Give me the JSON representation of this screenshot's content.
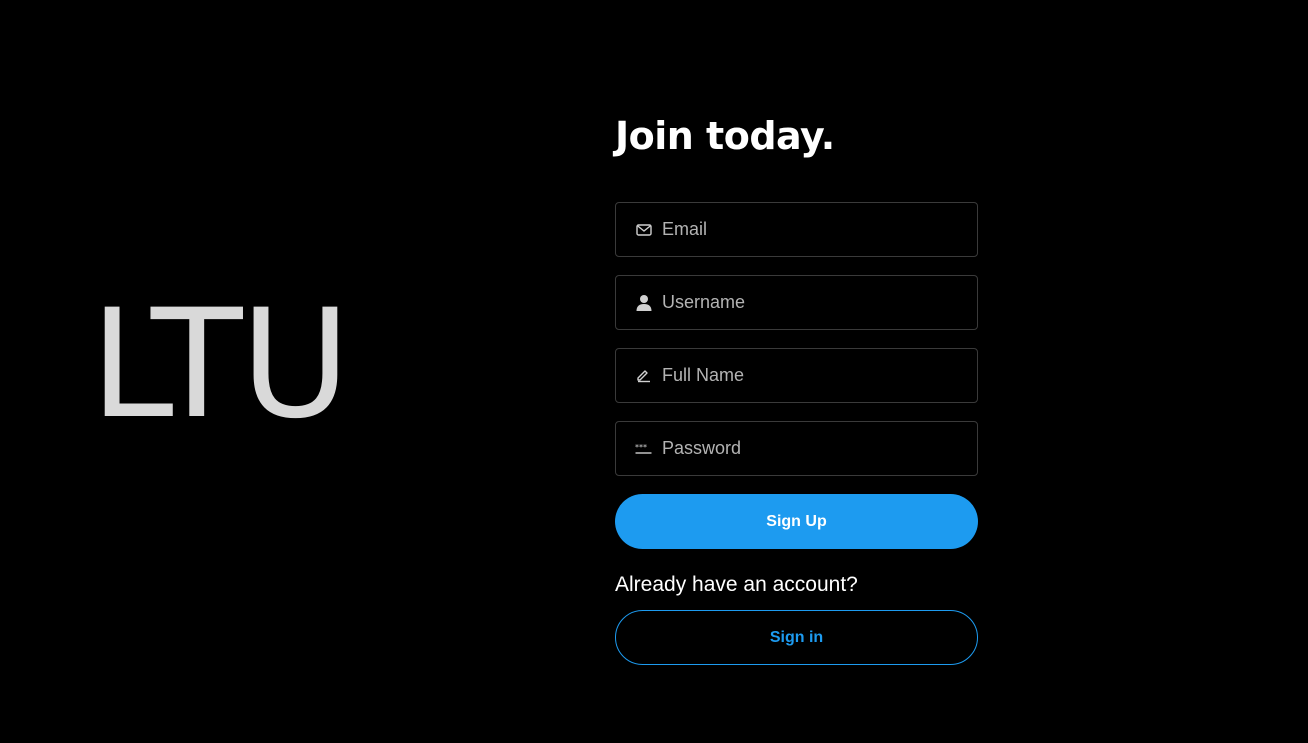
{
  "brand": {
    "logo_text": "LTU",
    "logo_color": "#d9d9d9"
  },
  "signup": {
    "title": "Join today.",
    "fields": [
      {
        "name": "email",
        "placeholder": "Email",
        "icon": "mail-icon",
        "value": ""
      },
      {
        "name": "username",
        "placeholder": "Username",
        "icon": "user-icon",
        "value": ""
      },
      {
        "name": "full_name",
        "placeholder": "Full Name",
        "icon": "pen-icon",
        "value": ""
      },
      {
        "name": "password",
        "placeholder": "Password",
        "icon": "password-dots-icon",
        "value": ""
      }
    ],
    "submit_label": "Sign Up",
    "already_text": "Already have an account?",
    "signin_label": "Sign in"
  },
  "colors": {
    "background": "#000000",
    "accent": "#1d9bf0",
    "field_border": "#3a3a3a",
    "placeholder": "#b3b3b3"
  }
}
